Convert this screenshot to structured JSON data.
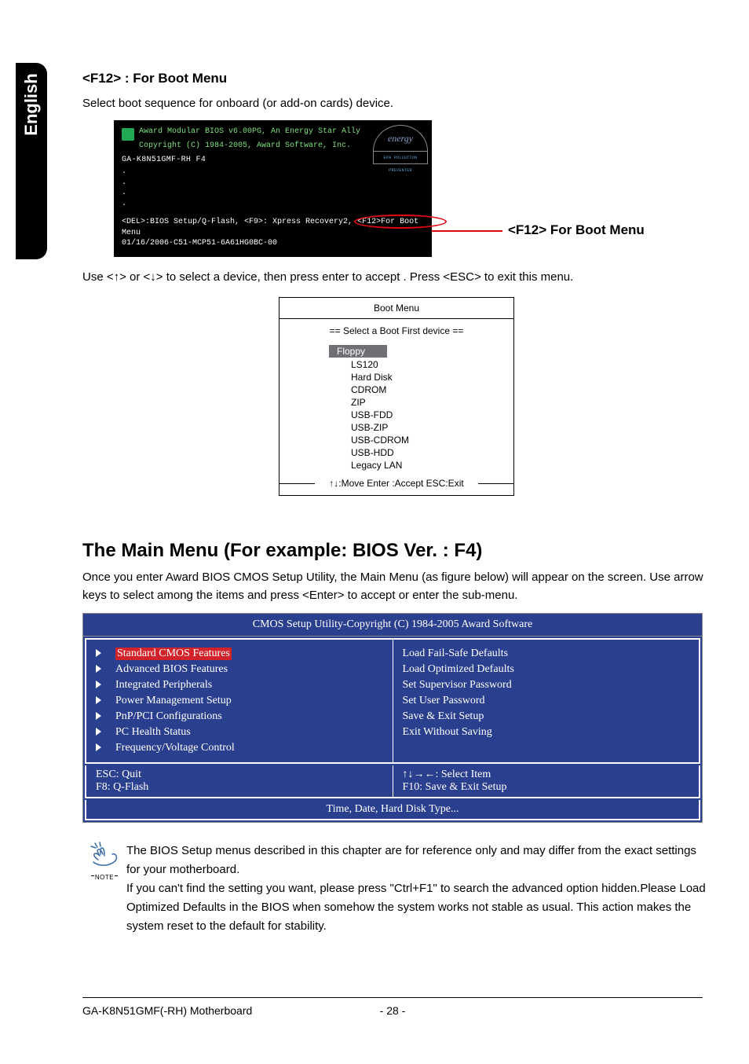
{
  "side_tab": "English",
  "section1": {
    "heading": "<F12> : For Boot Menu",
    "desc": "Select boot sequence for onboard (or add-on cards) device."
  },
  "post": {
    "line1": "Award Modular BIOS v6.00PG, An Energy Star Ally",
    "line2": "Copyright (C) 1984-2005, Award Software, Inc.",
    "model": "GA-K8N51GMF-RH F4",
    "keys_prefix": "<DEL>:BIOS Setup/Q-Flash, <F9>: Xpress Recovery2, ",
    "keys_circled": "<F12>For Boot Menu",
    "date_line": "01/16/2006-C51-MCP51-6A61HG0BC-00",
    "energy_script": "energy",
    "energy_sub": "EPA POLLUTION PREVENTER",
    "callout": "<F12> For Boot Menu"
  },
  "instruction": "Use <↑> or <↓> to select a device, then press enter to accept . Press <ESC> to exit this menu.",
  "boot_menu": {
    "title": "Boot Menu",
    "select_label": "==  Select a Boot First device  ==",
    "items": [
      "Floppy",
      "LS120",
      "Hard Disk",
      "CDROM",
      "ZIP",
      "USB-FDD",
      "USB-ZIP",
      "USB-CDROM",
      "USB-HDD",
      "Legacy LAN"
    ],
    "hints": "↑↓:Move   Enter :Accept   ESC:Exit"
  },
  "main_menu": {
    "heading": "The Main Menu (For example: BIOS Ver. : F4)",
    "desc": "Once you enter Award BIOS CMOS Setup Utility, the Main Menu (as figure below) will appear on the screen. Use arrow keys to select among the items and press <Enter> to accept or enter the sub-menu."
  },
  "cmos": {
    "title": "CMOS Setup Utility-Copyright (C) 1984-2005 Award Software",
    "left": [
      "Standard CMOS Features",
      "Advanced BIOS Features",
      "Integrated Peripherals",
      "Power Management Setup",
      "PnP/PCI Configurations",
      "PC Health Status",
      "Frequency/Voltage Control"
    ],
    "right": [
      "Load Fail-Safe Defaults",
      "Load Optimized Defaults",
      "Set Supervisor Password",
      "Set User Password",
      "Save & Exit Setup",
      "Exit Without Saving"
    ],
    "keys_left": [
      "ESC: Quit",
      "F8: Q-Flash"
    ],
    "keys_right": [
      "↑↓→←: Select Item",
      "F10: Save & Exit Setup"
    ],
    "hint": "Time, Date, Hard Disk Type..."
  },
  "note": {
    "label": "NOTE",
    "text": "The BIOS Setup menus described in this chapter are for reference only and may differ from the exact settings for your motherboard.\nIf you can't find the setting you want, please press \"Ctrl+F1\" to search the advanced option hidden.Please Load Optimized Defaults in the BIOS when somehow the system works not stable as usual. This action makes the system reset to the default for stability."
  },
  "footer": {
    "left": "GA-K8N51GMF(-RH) Motherboard",
    "page": "- 28 -"
  }
}
